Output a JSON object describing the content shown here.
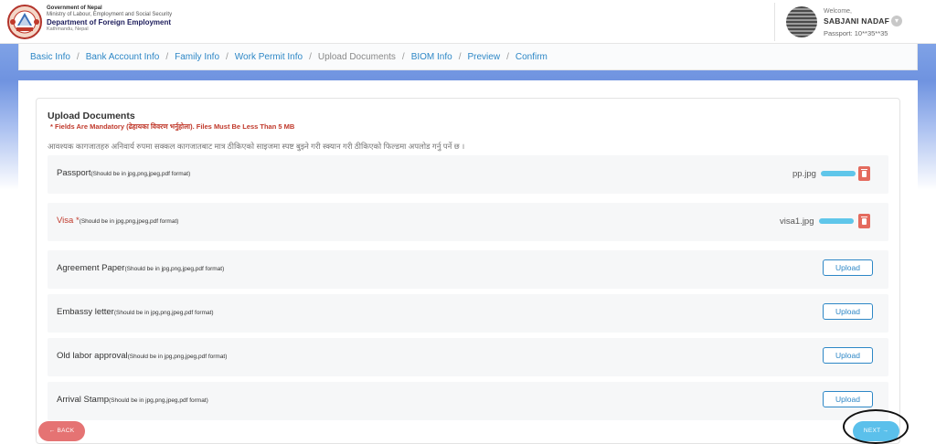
{
  "header": {
    "gov_line1": "Government of Nepal",
    "gov_line2": "Ministry of Labour, Employment and Social Security",
    "gov_line3": "Department of Foreign Employment",
    "gov_line4": "Kathmandu, Nepal",
    "user": {
      "welcome": "Welcome,",
      "name": "SABJANI NADAF J",
      "passport": "Passport: 10**35**35"
    }
  },
  "breadcrumb": [
    {
      "label": "Basic Info",
      "active": false
    },
    {
      "label": "Bank Account Info",
      "active": false
    },
    {
      "label": "Family Info",
      "active": false
    },
    {
      "label": "Work Permit Info",
      "active": false
    },
    {
      "label": "Upload Documents",
      "active": true
    },
    {
      "label": "BIOM Info",
      "active": false
    },
    {
      "label": "Preview",
      "active": false
    },
    {
      "label": "Confirm",
      "active": false
    }
  ],
  "section": {
    "title": "Upload Documents",
    "mandatory_note": "* Fields Are Mandatory (ढेहायका विवरण भर्नुहोला). Files Must Be Less Than 5 MB",
    "nepali_instruction": "आवश्यक कागजातहरु अनिवार्य रुपमा सक्कल कागजातबाट मात्र ठीकिएको साइजमा स्पष्ट बुझ्ने गरी स्क्यान गरी ठीकिएको फिल्डमा अपलोड गर्नु पर्ने छ ।"
  },
  "documents": [
    {
      "label": "Passport",
      "required": false,
      "hint": "(Should be in jpg,png,jpeg,pdf format)",
      "file": "pp.jpg",
      "upload_label": ""
    },
    {
      "label": "Visa *",
      "required": true,
      "hint": "(Should be in jpg,png,jpeg,pdf format)",
      "file": "visa1.jpg",
      "upload_label": ""
    },
    {
      "label": "Agreement Paper",
      "required": false,
      "hint": "(Should be in jpg,png,jpeg,pdf format)",
      "file": "",
      "upload_label": "Upload"
    },
    {
      "label": "Embassy letter",
      "required": false,
      "hint": "(Should be in jpg,png,jpeg,pdf format)",
      "file": "",
      "upload_label": "Upload"
    },
    {
      "label": "Old labor approval",
      "required": false,
      "hint": "(Should be in jpg,png,jpeg,pdf format)",
      "file": "",
      "upload_label": "Upload"
    },
    {
      "label": "Arrival Stamp",
      "required": false,
      "hint": "(Should be in jpg,png,jpeg,pdf format)",
      "file": "",
      "upload_label": "Upload"
    }
  ],
  "footer": {
    "back_label": "BACK",
    "next_label": "NEXT"
  },
  "colors": {
    "link": "#2d87c6",
    "danger": "#e57373",
    "next": "#5bc0eb",
    "progress": "#5fc6ea"
  }
}
